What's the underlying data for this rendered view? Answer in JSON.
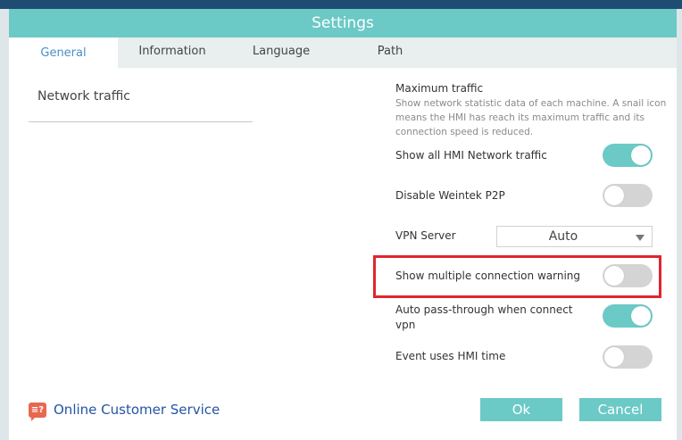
{
  "dialog": {
    "title": "Settings"
  },
  "tabs": [
    {
      "label": "General",
      "active": true
    },
    {
      "label": "Information",
      "active": false
    },
    {
      "label": "Language",
      "active": false
    },
    {
      "label": "Path",
      "active": false
    }
  ],
  "section": {
    "title": "Network traffic"
  },
  "max_traffic": {
    "heading": "Maximum traffic",
    "description": "Show network statistic data of each machine. A snail icon means the HMI has reach its maximum traffic and its connection speed is reduced."
  },
  "settings": {
    "show_all_traffic": {
      "label": "Show all HMI Network traffic",
      "on": true
    },
    "disable_p2p": {
      "label": "Disable Weintek P2P",
      "on": false
    },
    "vpn_server": {
      "label": "VPN Server",
      "value": "Auto"
    },
    "multi_conn_warning": {
      "label": "Show multiple connection warning",
      "on": false
    },
    "auto_pass_through": {
      "label": "Auto pass-through when connect vpn",
      "on": true
    },
    "event_hmi_time": {
      "label": "Event uses HMI time",
      "on": false
    }
  },
  "footer": {
    "customer_service": "Online Customer Service",
    "ok_label": "Ok",
    "cancel_label": "Cancel"
  },
  "colors": {
    "accent": "#6bc9c6",
    "highlight": "#e0262e",
    "link": "#2454a6"
  }
}
